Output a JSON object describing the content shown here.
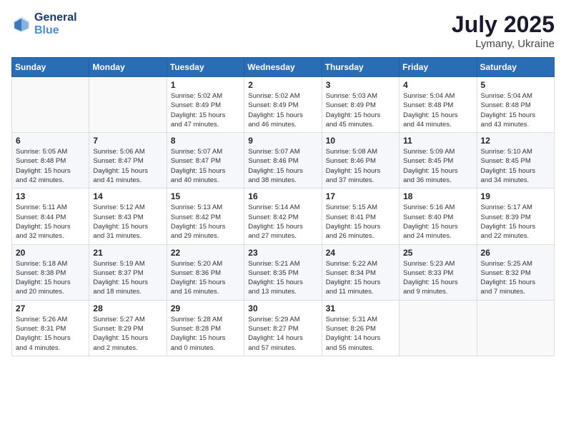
{
  "header": {
    "logo_line1": "General",
    "logo_line2": "Blue",
    "month_year": "July 2025",
    "location": "Lymany, Ukraine"
  },
  "weekdays": [
    "Sunday",
    "Monday",
    "Tuesday",
    "Wednesday",
    "Thursday",
    "Friday",
    "Saturday"
  ],
  "weeks": [
    [
      {
        "day": "",
        "info": ""
      },
      {
        "day": "",
        "info": ""
      },
      {
        "day": "1",
        "info": "Sunrise: 5:02 AM\nSunset: 8:49 PM\nDaylight: 15 hours\nand 47 minutes."
      },
      {
        "day": "2",
        "info": "Sunrise: 5:02 AM\nSunset: 8:49 PM\nDaylight: 15 hours\nand 46 minutes."
      },
      {
        "day": "3",
        "info": "Sunrise: 5:03 AM\nSunset: 8:49 PM\nDaylight: 15 hours\nand 45 minutes."
      },
      {
        "day": "4",
        "info": "Sunrise: 5:04 AM\nSunset: 8:48 PM\nDaylight: 15 hours\nand 44 minutes."
      },
      {
        "day": "5",
        "info": "Sunrise: 5:04 AM\nSunset: 8:48 PM\nDaylight: 15 hours\nand 43 minutes."
      }
    ],
    [
      {
        "day": "6",
        "info": "Sunrise: 5:05 AM\nSunset: 8:48 PM\nDaylight: 15 hours\nand 42 minutes."
      },
      {
        "day": "7",
        "info": "Sunrise: 5:06 AM\nSunset: 8:47 PM\nDaylight: 15 hours\nand 41 minutes."
      },
      {
        "day": "8",
        "info": "Sunrise: 5:07 AM\nSunset: 8:47 PM\nDaylight: 15 hours\nand 40 minutes."
      },
      {
        "day": "9",
        "info": "Sunrise: 5:07 AM\nSunset: 8:46 PM\nDaylight: 15 hours\nand 38 minutes."
      },
      {
        "day": "10",
        "info": "Sunrise: 5:08 AM\nSunset: 8:46 PM\nDaylight: 15 hours\nand 37 minutes."
      },
      {
        "day": "11",
        "info": "Sunrise: 5:09 AM\nSunset: 8:45 PM\nDaylight: 15 hours\nand 36 minutes."
      },
      {
        "day": "12",
        "info": "Sunrise: 5:10 AM\nSunset: 8:45 PM\nDaylight: 15 hours\nand 34 minutes."
      }
    ],
    [
      {
        "day": "13",
        "info": "Sunrise: 5:11 AM\nSunset: 8:44 PM\nDaylight: 15 hours\nand 32 minutes."
      },
      {
        "day": "14",
        "info": "Sunrise: 5:12 AM\nSunset: 8:43 PM\nDaylight: 15 hours\nand 31 minutes."
      },
      {
        "day": "15",
        "info": "Sunrise: 5:13 AM\nSunset: 8:42 PM\nDaylight: 15 hours\nand 29 minutes."
      },
      {
        "day": "16",
        "info": "Sunrise: 5:14 AM\nSunset: 8:42 PM\nDaylight: 15 hours\nand 27 minutes."
      },
      {
        "day": "17",
        "info": "Sunrise: 5:15 AM\nSunset: 8:41 PM\nDaylight: 15 hours\nand 26 minutes."
      },
      {
        "day": "18",
        "info": "Sunrise: 5:16 AM\nSunset: 8:40 PM\nDaylight: 15 hours\nand 24 minutes."
      },
      {
        "day": "19",
        "info": "Sunrise: 5:17 AM\nSunset: 8:39 PM\nDaylight: 15 hours\nand 22 minutes."
      }
    ],
    [
      {
        "day": "20",
        "info": "Sunrise: 5:18 AM\nSunset: 8:38 PM\nDaylight: 15 hours\nand 20 minutes."
      },
      {
        "day": "21",
        "info": "Sunrise: 5:19 AM\nSunset: 8:37 PM\nDaylight: 15 hours\nand 18 minutes."
      },
      {
        "day": "22",
        "info": "Sunrise: 5:20 AM\nSunset: 8:36 PM\nDaylight: 15 hours\nand 16 minutes."
      },
      {
        "day": "23",
        "info": "Sunrise: 5:21 AM\nSunset: 8:35 PM\nDaylight: 15 hours\nand 13 minutes."
      },
      {
        "day": "24",
        "info": "Sunrise: 5:22 AM\nSunset: 8:34 PM\nDaylight: 15 hours\nand 11 minutes."
      },
      {
        "day": "25",
        "info": "Sunrise: 5:23 AM\nSunset: 8:33 PM\nDaylight: 15 hours\nand 9 minutes."
      },
      {
        "day": "26",
        "info": "Sunrise: 5:25 AM\nSunset: 8:32 PM\nDaylight: 15 hours\nand 7 minutes."
      }
    ],
    [
      {
        "day": "27",
        "info": "Sunrise: 5:26 AM\nSunset: 8:31 PM\nDaylight: 15 hours\nand 4 minutes."
      },
      {
        "day": "28",
        "info": "Sunrise: 5:27 AM\nSunset: 8:29 PM\nDaylight: 15 hours\nand 2 minutes."
      },
      {
        "day": "29",
        "info": "Sunrise: 5:28 AM\nSunset: 8:28 PM\nDaylight: 15 hours\nand 0 minutes."
      },
      {
        "day": "30",
        "info": "Sunrise: 5:29 AM\nSunset: 8:27 PM\nDaylight: 14 hours\nand 57 minutes."
      },
      {
        "day": "31",
        "info": "Sunrise: 5:31 AM\nSunset: 8:26 PM\nDaylight: 14 hours\nand 55 minutes."
      },
      {
        "day": "",
        "info": ""
      },
      {
        "day": "",
        "info": ""
      }
    ]
  ]
}
